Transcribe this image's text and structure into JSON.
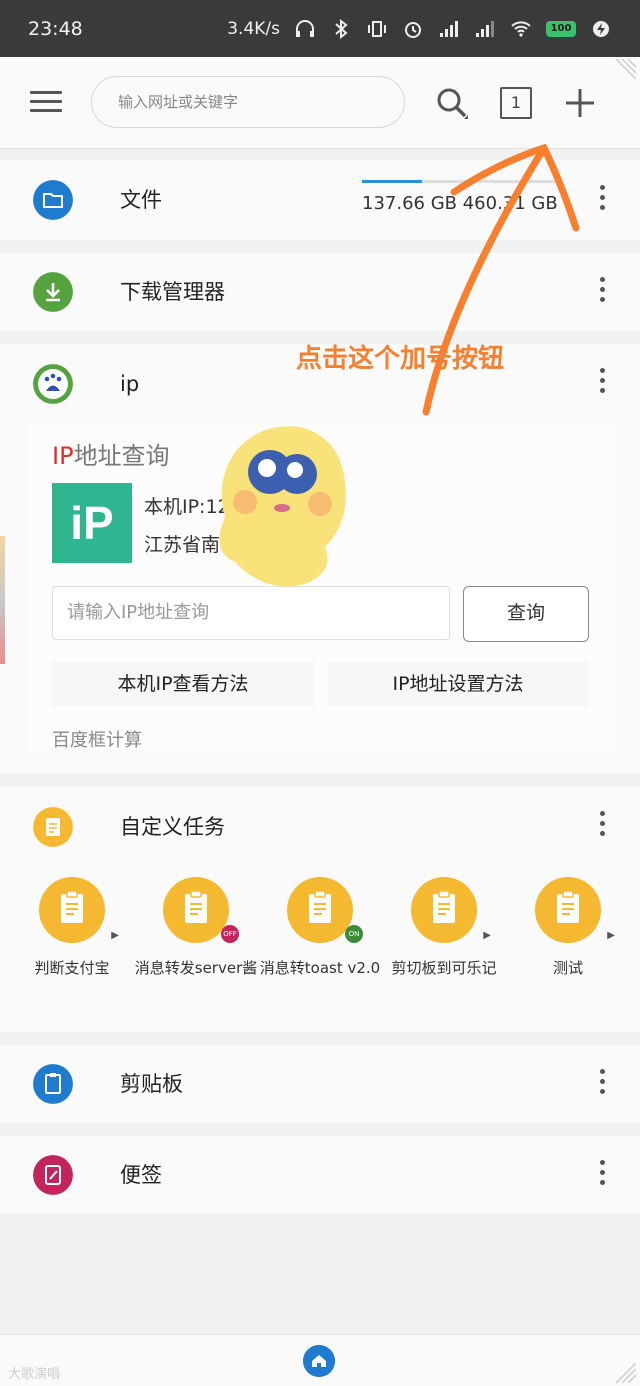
{
  "status_bar": {
    "time": "23:48",
    "net_speed": "3.4K/s",
    "battery": "100"
  },
  "toolbar": {
    "search_placeholder": "输入网址或关键字",
    "tab_count": "1"
  },
  "files_card": {
    "label": "文件",
    "storage_text": "137.66 GB 460.31 GB",
    "storage_used_fraction": 0.3
  },
  "downloads_card": {
    "label": "下载管理器"
  },
  "ip_card": {
    "label": "ip",
    "widget_title_red": "IP",
    "widget_title_rest": "地址查询",
    "logo_text": "iP",
    "local_ip_line": "本机IP:12        .2",
    "location_line": "江苏省南",
    "input_placeholder": "请输入IP地址查询",
    "query_button": "查询",
    "link_view_method": "本机IP查看方法",
    "link_setup_method": "IP地址设置方法",
    "footer": "百度框计算"
  },
  "annotation": {
    "text": "点击这个加号按钮",
    "color": "#f77f2d"
  },
  "tasks_card": {
    "label": "自定义任务",
    "items": [
      {
        "name": "判断支付宝",
        "badge": ""
      },
      {
        "name": "消息转发server酱",
        "badge": "OFF"
      },
      {
        "name": "消息转toast v2.0",
        "badge": "ON"
      },
      {
        "name": "剪切板到可乐记",
        "badge": ""
      },
      {
        "name": "测试",
        "badge": ""
      }
    ]
  },
  "clipboard_card": {
    "label": "剪贴板"
  },
  "notes_card": {
    "label": "便签"
  },
  "watermark": "大歌演唱",
  "colors": {
    "files_icon": "#1e7bd0",
    "download_icon": "#54a33e",
    "task_icon": "#f4b931",
    "clipboard_icon": "#1e7bd0",
    "notes_icon": "#c3245b",
    "accent": "#2a8fd4"
  }
}
